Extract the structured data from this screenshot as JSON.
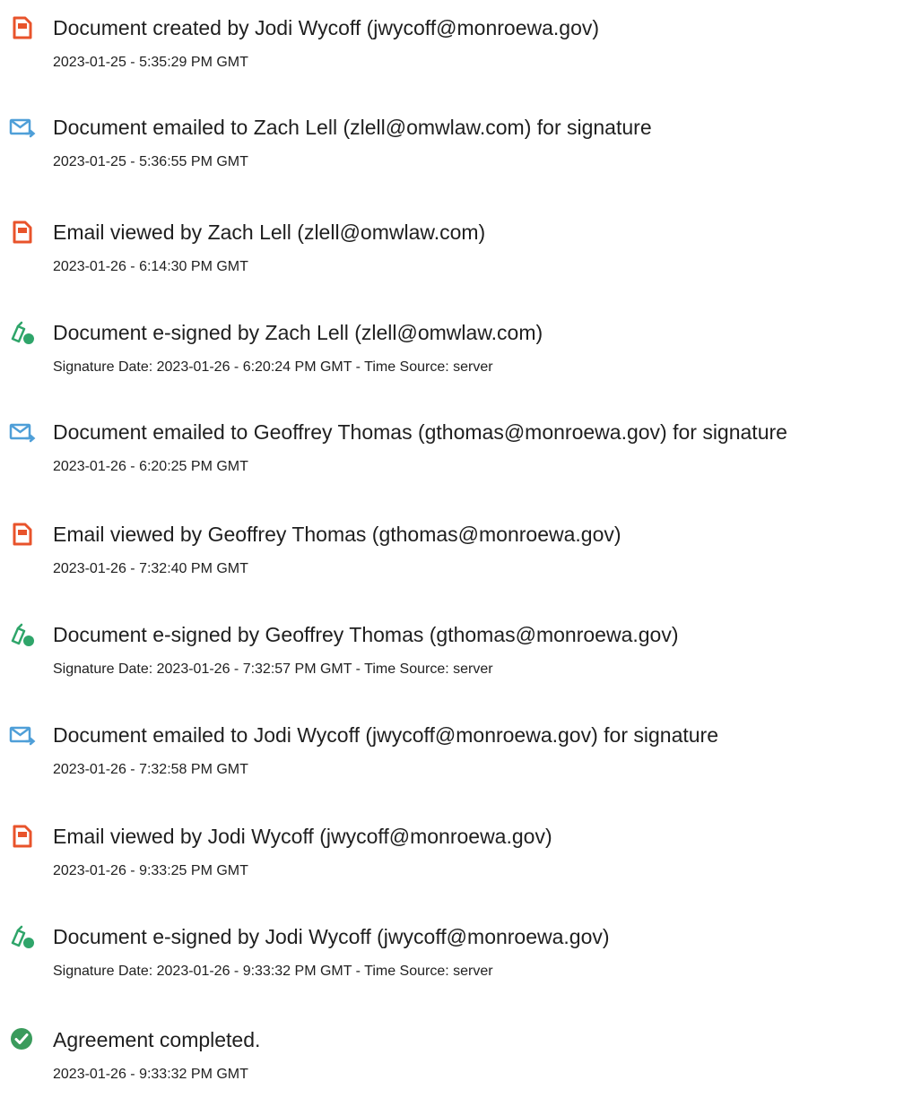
{
  "events": [
    {
      "icon": "document-icon",
      "title": "Document created by Jodi Wycoff (jwycoff@monroewa.gov)",
      "detail": "2023-01-25 - 5:35:29 PM GMT"
    },
    {
      "icon": "email-sent-icon",
      "title": "Document emailed to Zach Lell (zlell@omwlaw.com) for signature",
      "detail": "2023-01-25 - 5:36:55 PM GMT"
    },
    {
      "icon": "document-icon",
      "title": "Email viewed by Zach Lell (zlell@omwlaw.com)",
      "detail": "2023-01-26 - 6:14:30 PM GMT"
    },
    {
      "icon": "esign-pen-icon",
      "title": "Document e-signed by Zach Lell (zlell@omwlaw.com)",
      "detail": "Signature Date: 2023-01-26 - 6:20:24 PM GMT - Time Source: server"
    },
    {
      "icon": "email-sent-icon",
      "title": "Document emailed to Geoffrey Thomas (gthomas@monroewa.gov) for signature",
      "detail": "2023-01-26 - 6:20:25 PM GMT"
    },
    {
      "icon": "document-icon",
      "title": "Email viewed by Geoffrey Thomas (gthomas@monroewa.gov)",
      "detail": "2023-01-26 - 7:32:40 PM GMT"
    },
    {
      "icon": "esign-pen-icon",
      "title": "Document e-signed by Geoffrey Thomas (gthomas@monroewa.gov)",
      "detail": "Signature Date: 2023-01-26 - 7:32:57 PM GMT - Time Source: server"
    },
    {
      "icon": "email-sent-icon",
      "title": "Document emailed to Jodi Wycoff (jwycoff@monroewa.gov) for signature",
      "detail": "2023-01-26 - 7:32:58 PM GMT"
    },
    {
      "icon": "document-icon",
      "title": "Email viewed by Jodi Wycoff (jwycoff@monroewa.gov)",
      "detail": "2023-01-26 - 9:33:25 PM GMT"
    },
    {
      "icon": "esign-pen-icon",
      "title": "Document e-signed by Jodi Wycoff (jwycoff@monroewa.gov)",
      "detail": "Signature Date: 2023-01-26 - 9:33:32 PM GMT - Time Source: server"
    },
    {
      "icon": "check-circle-icon",
      "title": "Agreement completed.",
      "detail": "2023-01-26 - 9:33:32 PM GMT"
    }
  ],
  "colors": {
    "document_icon": "#e8532b",
    "email_icon": "#4f9fd8",
    "esign_icon": "#2fa56a",
    "check_icon": "#3a9b5c",
    "text": "#1f1f1f"
  }
}
